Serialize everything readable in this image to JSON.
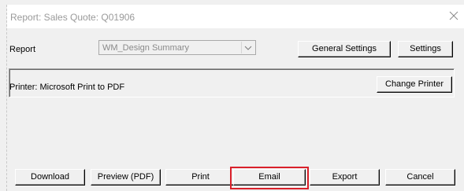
{
  "dialog": {
    "title": "Report: Sales Quote: Q01906"
  },
  "report_row": {
    "label": "Report",
    "selected_report": "WM_Design Summary",
    "general_settings_label": "General Settings",
    "settings_label": "Settings"
  },
  "printer": {
    "label": "Printer: Microsoft Print to PDF",
    "change_printer_label": "Change Printer"
  },
  "actions": {
    "download": "Download",
    "preview": "Preview (PDF)",
    "print": "Print",
    "email": "Email",
    "export": "Export",
    "cancel": "Cancel"
  },
  "colors": {
    "highlight": "#d9202a",
    "dialog_bg": "#f0f0f0"
  }
}
